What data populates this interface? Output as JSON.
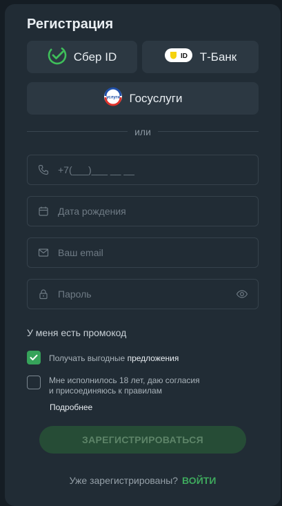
{
  "title": "Регистрация",
  "social": {
    "sber_label": "Сбер ID",
    "tbank_label": "Т-Банк",
    "tbank_badge": "ID",
    "gosuslugi_label": "Госуслуги",
    "gosuslugi_logo_text": "услуги"
  },
  "divider_text": "или",
  "fields": {
    "phone_placeholder": "+7(___)___ __ __",
    "birthdate_placeholder": "Дата рождения",
    "email_placeholder": "Ваш email",
    "password_placeholder": "Пароль"
  },
  "promo_label": "У меня есть промокод",
  "checkboxes": {
    "offers_prefix": "Получать выгодные",
    "offers_link": "предложения",
    "offers_checked": true,
    "age_line1": "Мне исполнилось 18 лет, даю согласия",
    "age_line2": "и присоединяюсь к правилам",
    "age_checked": false,
    "more_label": "Подробнее"
  },
  "submit_label": "ЗАРЕГИСТРИРОВАТЬСЯ",
  "login": {
    "question": "Уже зарегистрированы?",
    "link": "ВОЙТИ"
  },
  "colors": {
    "panel": "#212c35",
    "accent_green": "#3ea95d",
    "submit_disabled": "#264c36"
  }
}
